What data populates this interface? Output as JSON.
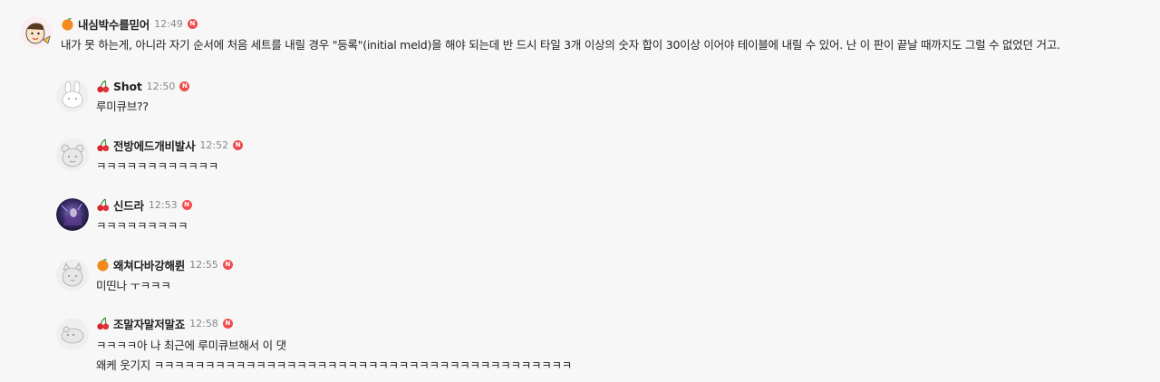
{
  "comments": [
    {
      "nickname": "내심박수를믿어",
      "time": "12:49",
      "badge_icon": "orange-icon",
      "new_label": "N",
      "lines": [
        "내가 못 하는게, 아니라 자기 순서에 처음 세트를 내릴 경우 \"등록\"(initial meld)을 해야 되는데 반 드시 타일 3개 이상의 숫자 합이 30이상 이어야 테이블에 내릴 수 있어. 난 이 판이 끝날 때까지도 그럴 수 없었던 거고."
      ]
    },
    {
      "nickname": "Shot",
      "time": "12:50",
      "badge_icon": "cherry-icon",
      "new_label": "N",
      "lines": [
        "루미큐브??"
      ]
    },
    {
      "nickname": "전방에드개비발사",
      "time": "12:52",
      "badge_icon": "cherry-icon",
      "new_label": "N",
      "lines": [
        "ㅋㅋㅋㅋㅋㅋㅋㅋㅋㅋㅋㅋ"
      ]
    },
    {
      "nickname": "신드라",
      "time": "12:53",
      "badge_icon": "cherry-icon",
      "new_label": "N",
      "lines": [
        "ㅋㅋㅋㅋㅋㅋㅋㅋㅋ"
      ]
    },
    {
      "nickname": "왜쳐다바강해륀",
      "time": "12:55",
      "badge_icon": "orange-icon",
      "new_label": "N",
      "lines": [
        "미띤나 ㅜㅋㅋㅋ"
      ]
    },
    {
      "nickname": "조말자말저말죠",
      "time": "12:58",
      "badge_icon": "cherry-icon",
      "new_label": "N",
      "lines": [
        "ㅋㅋㅋㅋ아 나 최근에 루미큐브해서 이 댓",
        "왜케 웃기지 ㅋㅋㅋㅋㅋㅋㅋㅋㅋㅋㅋㅋㅋㅋㅋㅋㅋㅋㅋㅋㅋㅋㅋㅋㅋㅋㅋㅋㅋㅋㅋㅋㅋㅋㅋㅋㅋㅋㅋㅋㅋ"
      ]
    }
  ]
}
